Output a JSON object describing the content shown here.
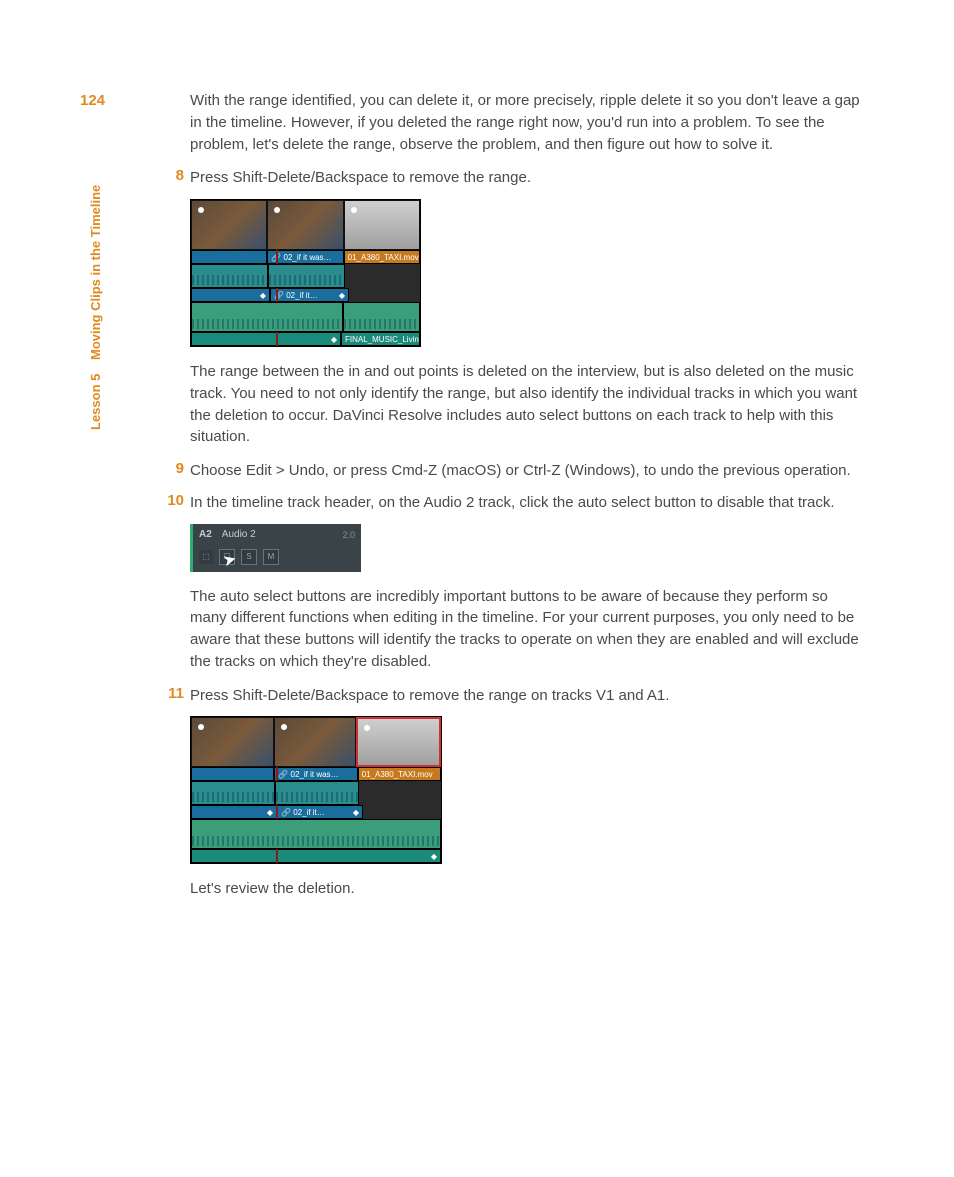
{
  "page_number": "124",
  "sidebar": {
    "lesson": "Lesson 5",
    "title": "Moving Clips in the Timeline"
  },
  "para1": "With the range identified, you can delete it, or more precisely, ripple delete it so you don't leave a gap in the timeline. However, if you deleted the range right now, you'd run into a problem. To see the problem, let's delete the range, observe the problem, and then figure out how to solve it.",
  "step8": {
    "num": "8",
    "text": "Press Shift-Delete/Backspace to remove the range."
  },
  "fig1": {
    "clips": {
      "v_label_1": "02_if it was…",
      "v_label_2": "01_A380_TAXI.mov",
      "a_label": "02_if it…",
      "music": "FINAL_MUSIC_Living_in_the_Age_of_Airplan"
    },
    "link_glyph": "🔗",
    "marker_glyph": "◆"
  },
  "para2": "The range between the in and out points is deleted on the interview, but is also deleted on the music track. You need to not only identify the range, but also identify the individual tracks in which you want the deletion to occur. DaVinci Resolve includes auto select buttons on each track to help with this situation.",
  "step9": {
    "num": "9",
    "text": "Choose Edit > Undo, or press Cmd-Z (macOS) or Ctrl-Z (Windows), to undo the previous operation."
  },
  "step10": {
    "num": "10",
    "text": "In the timeline track header, on the Audio 2 track, click the auto select button to disable that track."
  },
  "fig2": {
    "a2": "A2",
    "name": "Audio 2",
    "ch": "2.0",
    "lock": "⬚",
    "auto": "☐",
    "solo": "S",
    "mute": "M",
    "cursor": "➤"
  },
  "para3": "The auto select buttons are incredibly important buttons to be aware of because they perform so many different functions when editing in the timeline. For your current purposes, you only need to be aware that these buttons will identify the tracks to operate on when they are enabled and will exclude the tracks on which they're disabled.",
  "step11": {
    "num": "11",
    "text": "Press Shift-Delete/Backspace to remove the range on tracks V1 and A1."
  },
  "fig3": {
    "clips": {
      "v_label_1": "02_if it was…",
      "v_label_2": "01_A380_TAXI.mov",
      "a_label": "02_if it…"
    },
    "link_glyph": "🔗",
    "marker_glyph": "◆"
  },
  "para4": "Let's review the deletion."
}
